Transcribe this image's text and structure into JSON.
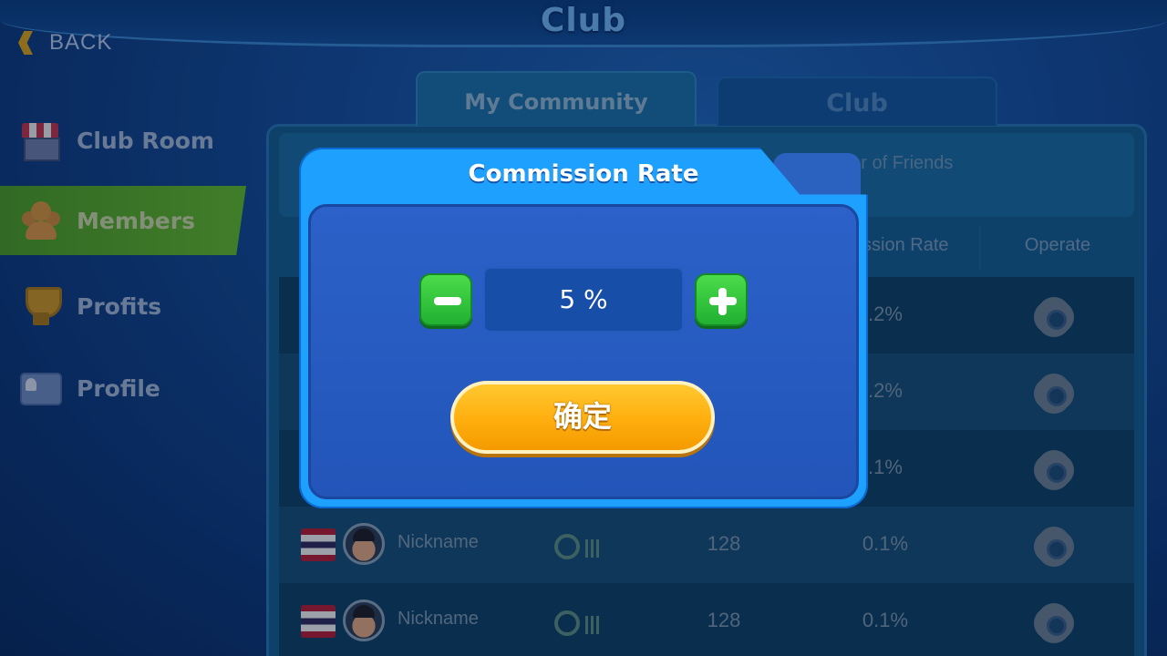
{
  "header": {
    "title": "Club",
    "back_label": "BACK"
  },
  "sidebar": {
    "items": [
      {
        "label": "Club Room",
        "icon": "store-icon"
      },
      {
        "label": "Members",
        "icon": "members-icon",
        "active": true
      },
      {
        "label": "Profits",
        "icon": "trophy-icon"
      },
      {
        "label": "Profile",
        "icon": "id-card-icon"
      }
    ]
  },
  "tabs": [
    {
      "label": "My Community",
      "active": true
    },
    {
      "label": "Club",
      "active": false
    }
  ],
  "info": {
    "friends_text": "ber of Friends"
  },
  "table": {
    "headers": {
      "rate": "ssion Rate",
      "operate": "Operate"
    },
    "rows": [
      {
        "nickname": "",
        "count": "",
        "rate": ".2%"
      },
      {
        "nickname": "",
        "count": "",
        "rate": ".2%"
      },
      {
        "nickname": "",
        "count": "",
        "rate": ".1%"
      },
      {
        "nickname": "Nickname",
        "count": "128",
        "rate": "0.1%"
      },
      {
        "nickname": "Nickname",
        "count": "128",
        "rate": "0.1%"
      }
    ]
  },
  "modal": {
    "title": "Commission Rate",
    "rate_value": "5 %",
    "confirm_label": "确定"
  },
  "colors": {
    "modal_accent": "#1ea0ff",
    "stepper_green": "#21b031",
    "confirm_orange": "#ffae0e",
    "active_sidebar": "#4b9b24"
  }
}
